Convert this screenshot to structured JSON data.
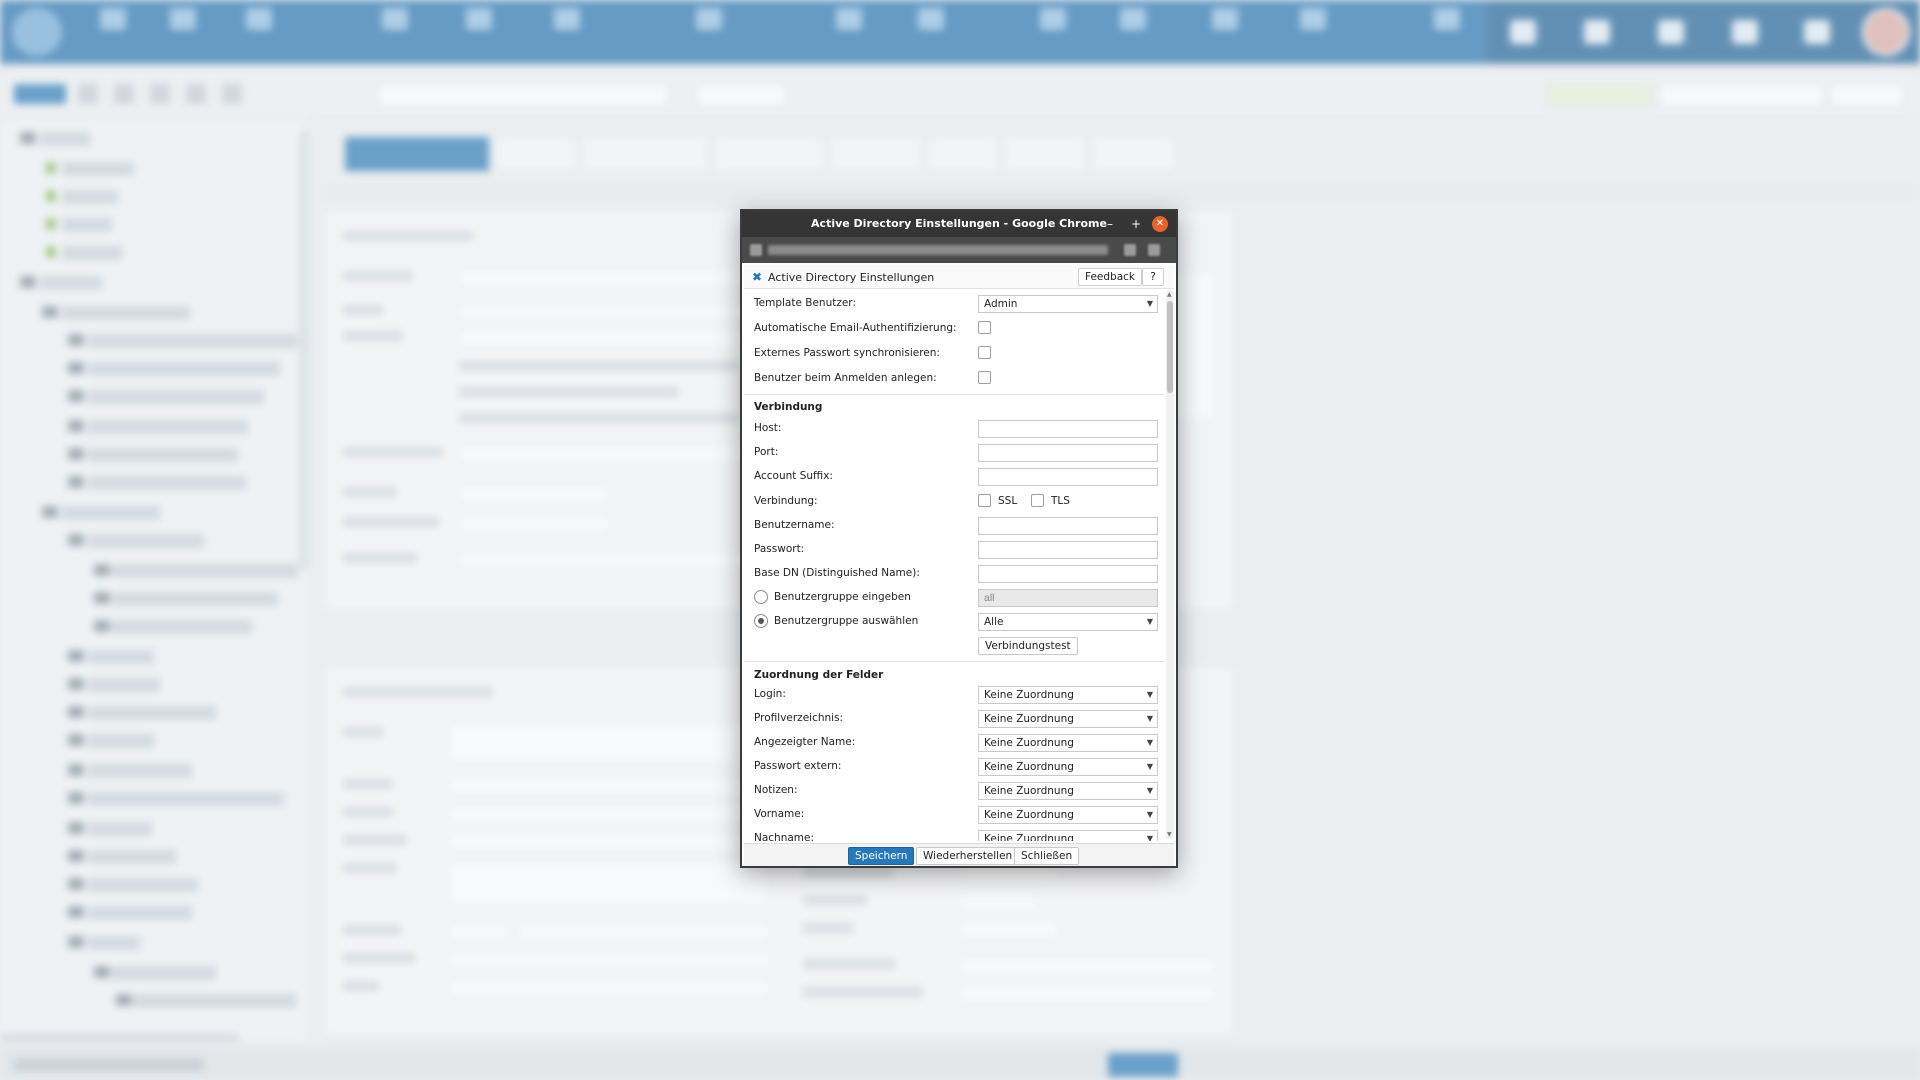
{
  "window": {
    "title": "Active Directory Einstellungen - Google Chrome",
    "minimize_glyph": "–",
    "maximize_glyph": "+",
    "close_glyph": "✕"
  },
  "dialog": {
    "header_title": "Active Directory Einstellungen",
    "header_icon": "tools-icon",
    "feedback_label": "Feedback",
    "help_label": "?",
    "fields": {
      "template_user": {
        "label": "Template Benutzer:",
        "value": "Admin"
      },
      "auto_email_auth": {
        "label": "Automatische Email-Authentifizierung:",
        "checked": false
      },
      "sync_external_password": {
        "label": "Externes Passwort synchronisieren:",
        "checked": false
      },
      "create_on_login": {
        "label": "Benutzer beim Anmelden anlegen:",
        "checked": false
      }
    },
    "connection": {
      "section_title": "Verbindung",
      "host_label": "Host:",
      "host_value": "",
      "port_label": "Port:",
      "port_value": "",
      "account_suffix_label": "Account Suffix:",
      "account_suffix_value": "",
      "connection_label": "Verbindung:",
      "ssl_label": "SSL",
      "ssl_checked": false,
      "tls_label": "TLS",
      "tls_checked": false,
      "username_label": "Benutzername:",
      "username_value": "",
      "password_label": "Passwort:",
      "password_value": "",
      "base_dn_label": "Base DN (Distinguished Name):",
      "base_dn_value": "",
      "group_enter_label": "Benutzergruppe eingeben",
      "group_enter_value": "all",
      "group_select_label": "Benutzergruppe auswählen",
      "group_select_value": "Alle",
      "test_button_label": "Verbindungstest"
    },
    "mapping": {
      "section_title": "Zuordnung der Felder",
      "rows": [
        {
          "label": "Login:",
          "value": "Keine Zuordnung"
        },
        {
          "label": "Profilverzeichnis:",
          "value": "Keine Zuordnung"
        },
        {
          "label": "Angezeigter Name:",
          "value": "Keine Zuordnung"
        },
        {
          "label": "Passwort extern:",
          "value": "Keine Zuordnung"
        },
        {
          "label": "Notizen:",
          "value": "Keine Zuordnung"
        },
        {
          "label": "Vorname:",
          "value": "Keine Zuordnung"
        },
        {
          "label": "Nachname:",
          "value": "Keine Zuordnung"
        }
      ]
    },
    "footer": {
      "save_label": "Speichern",
      "restore_label": "Wiederherstellen",
      "close_label": "Schließen"
    }
  },
  "colors": {
    "primary": "#2678b7",
    "topbar": "#1f6fad",
    "titlebar": "#353535",
    "close_button": "#e8632b"
  }
}
